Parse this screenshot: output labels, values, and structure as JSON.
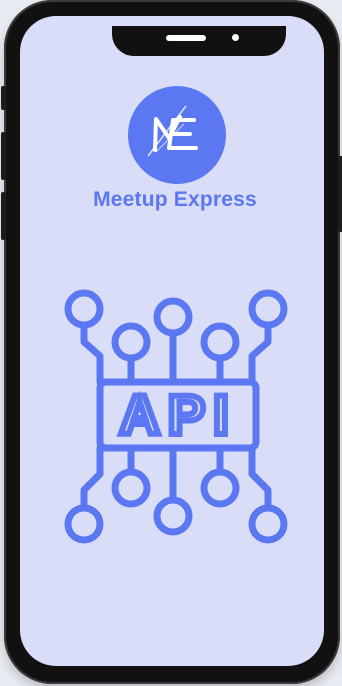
{
  "brand": {
    "name": "Meetup Express",
    "monogram": "ME",
    "color": "#5b77f2"
  },
  "illustration": {
    "label": "API",
    "icon": "api-circuit-icon",
    "color": "#5b77f2"
  },
  "device": {
    "frame_color": "#111111",
    "screen_color": "#d9ddf7"
  }
}
